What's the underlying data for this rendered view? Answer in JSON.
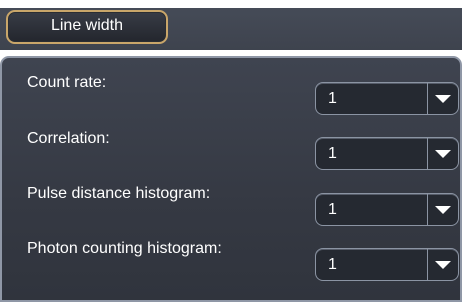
{
  "tabs": [
    {
      "label": "Line width"
    }
  ],
  "settings": [
    {
      "label": "Count rate:",
      "value": "1"
    },
    {
      "label": "Correlation:",
      "value": "1"
    },
    {
      "label": "Pulse distance histogram:",
      "value": "1"
    },
    {
      "label": "Photon counting histogram:",
      "value": "1"
    }
  ],
  "colors": {
    "tab_border": "#c9a66a",
    "panel_background": "#3f4450",
    "control_background": "#252931",
    "text": "#ffffff"
  }
}
